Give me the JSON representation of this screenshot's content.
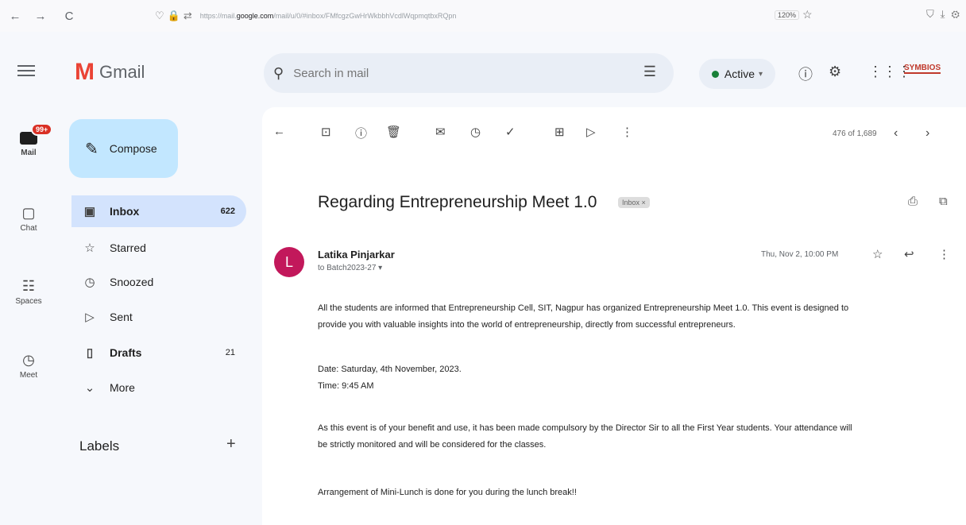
{
  "browser": {
    "back": "←",
    "forward": "→",
    "reload": "C",
    "url_prefix": "https://mail.",
    "url_domain": "google.com",
    "url_rest": "/mail/u/0/#inbox/FMfcgzGwHrWkbbhVcdlWqpmqtbxRQpn",
    "zoom": "120%"
  },
  "app": {
    "name": "Gmail"
  },
  "search": {
    "placeholder": "Search in mail"
  },
  "status": {
    "label": "Active"
  },
  "org_logo": "SYMBIOS",
  "rail": {
    "mail": "Mail",
    "mail_badge": "99+",
    "chat": "Chat",
    "spaces": "Spaces",
    "meet": "Meet"
  },
  "compose": {
    "label": "Compose"
  },
  "nav": [
    {
      "label": "Inbox",
      "count": "622"
    },
    {
      "label": "Starred",
      "count": ""
    },
    {
      "label": "Snoozed",
      "count": ""
    },
    {
      "label": "Sent",
      "count": ""
    },
    {
      "label": "Drafts",
      "count": "21"
    },
    {
      "label": "More",
      "count": ""
    }
  ],
  "labels": {
    "heading": "Labels",
    "add": "+"
  },
  "pager": {
    "text": "476 of 1,689"
  },
  "email": {
    "subject": "Regarding Entrepreneurship Meet 1.0",
    "chip": "Inbox ×",
    "avatar_letter": "L",
    "sender": "Latika Pinjarkar",
    "recipient": "to Batch2023-27 ▾",
    "date": "Thu, Nov 2, 10:00 PM",
    "p1_line1": "All the students are informed that Entrepreneurship Cell, SIT, Nagpur has organized Entrepreneurship Meet 1.0. This event is designed to",
    "p1_line2": "provide you with valuable insights into the world of entrepreneurship, directly from successful entrepreneurs.",
    "date_line": "Date: Saturday, 4th November, 2023.",
    "time_line": "Time: 9:45 AM",
    "p2_line1": "As this event is of your benefit and use, it has been made compulsory by the Director Sir  to all the First Year students. Your attendance will",
    "p2_line2": "be strictly monitored and will be considered for the classes.",
    "p3": "Arrangement of Mini-Lunch is done for you during the lunch break!!"
  }
}
